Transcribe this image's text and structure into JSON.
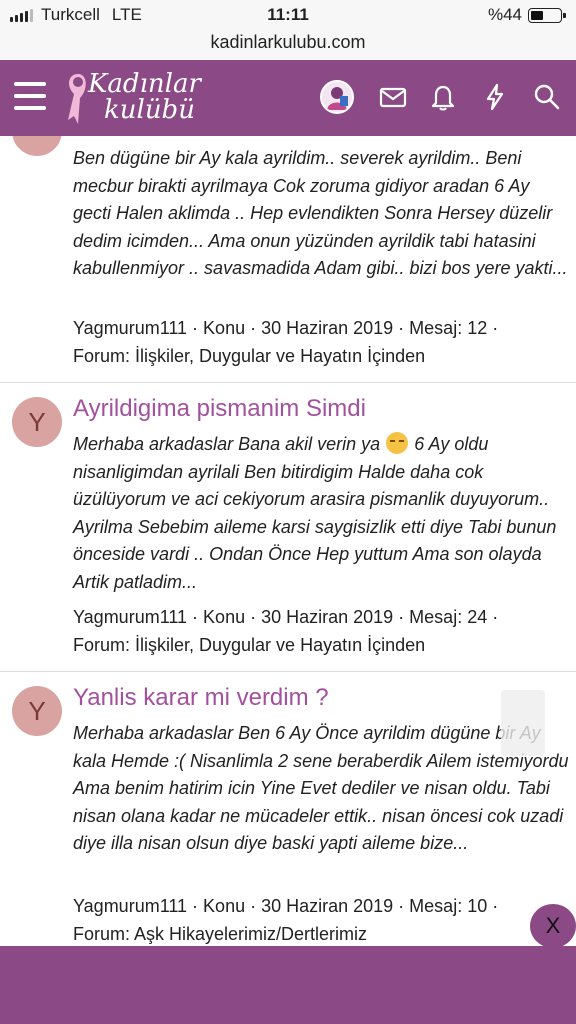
{
  "status": {
    "carrier": "Turkcell",
    "network": "LTE",
    "time": "11:11",
    "battery": "%44",
    "battery_level": 0.44
  },
  "browser": {
    "url": "kadinlarkulubu.com"
  },
  "header": {
    "logo_line1": "Kadınlar",
    "logo_line2": "kulübü",
    "icons": [
      "menu-icon",
      "avatar",
      "envelope-icon",
      "bell-icon",
      "bolt-icon",
      "search-icon"
    ]
  },
  "posts": [
    {
      "avatar_letter": "",
      "title": "",
      "snippet": "Ben dügüne bir Ay kala ayrildim.. severek ayrildim.. Beni mecbur birakti ayrilmaya Cok zoruma gidiyor aradan 6 Ay gecti Halen aklimda .. Hep evlendikten Sonra Hersey düzelir dedim icimden... Ama onun yüzünden ayrildik tabi hatasini kabullenmiyor .. savasmadida Adam gibi.. bizi bos yere yakti...",
      "meta_line1": "Yagmurum111 · Konu · 30 Haziran 2019 · Mesaj: 12 ·",
      "meta_line2": "Forum: İlişkiler, Duygular ve Hayatın İçinden"
    },
    {
      "avatar_letter": "Y",
      "title": "Ayrildigima pismanim Simdi",
      "snippet_before": "Merhaba arkadaslar Bana akil verin ya",
      "snippet_after": "6 Ay oldu nisanligimdan ayrilali Ben bitirdigim Halde daha cok üzülüyorum ve aci cekiyorum arasira pismanlik duyuyorum.. Ayrilma Sebebim aileme karsi saygisizlik etti diye Tabi bunun önceside vardi .. Ondan Önce Hep yuttum Ama son olayda Artik patladim...",
      "meta_line1": "Yagmurum111 · Konu · 30 Haziran 2019 · Mesaj: 24 ·",
      "meta_line2": "Forum: İlişkiler, Duygular ve Hayatın İçinden"
    },
    {
      "avatar_letter": "Y",
      "title": "Yanlis karar mi verdim ?",
      "snippet": "Merhaba arkadaslar Ben 6 Ay Önce ayrildim dügüne bir Ay kala Hemde :( Nisanlimla 2 sene beraberdik Ailem istemiyordu Ama benim hatirim icin Yine Evet dediler ve nisan oldu. Tabi nisan olana kadar ne mücadeler ettik.. nisan öncesi cok uzadi diye illa nisan olsun diye baski yapti aileme bize...",
      "meta_line1": "Yagmurum111 · Konu · 30 Haziran 2019 · Mesaj: 10 ·",
      "meta_line2": "Forum: Aşk Hikayelerimiz/Dertlerimiz"
    }
  ],
  "overlay": {
    "close_label": "X"
  },
  "colors": {
    "brand": "#8b4a86",
    "title_link": "#a3509e",
    "avatar_bg": "#d8a3a0"
  }
}
